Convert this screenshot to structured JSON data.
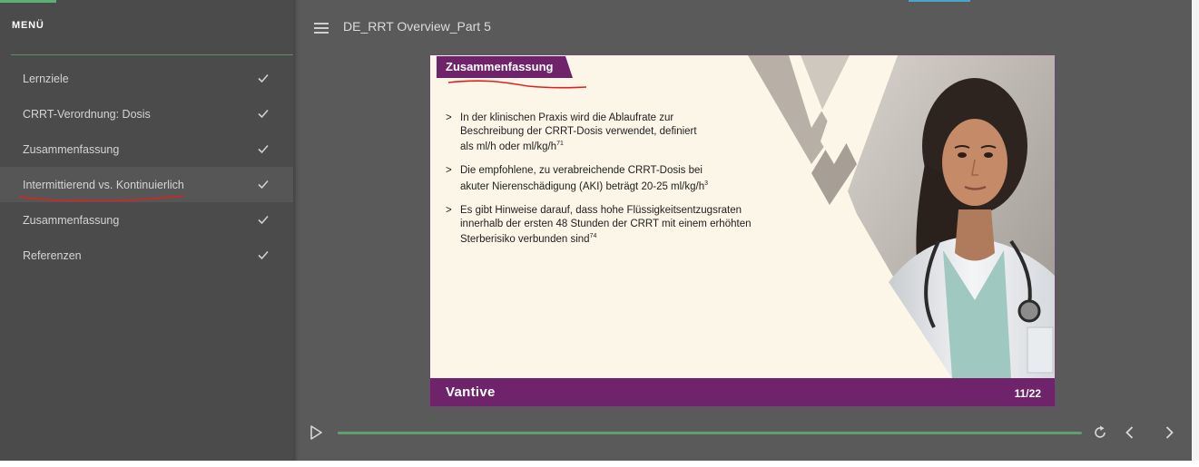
{
  "sidebar": {
    "title": "MENÜ",
    "items": [
      {
        "label": "Lernziele"
      },
      {
        "label": "CRRT-Verordnung: Dosis"
      },
      {
        "label": "Zusammenfassung"
      },
      {
        "label": "Intermittierend vs. Kontinuierlich"
      },
      {
        "label": "Zusammenfassung"
      },
      {
        "label": "Referenzen"
      }
    ],
    "active_index": 3
  },
  "header": {
    "title": "DE_RRT Overview_Part 5"
  },
  "slide": {
    "heading": "Zusammenfassung",
    "bullets": [
      {
        "line1": "In der klinischen Praxis wird die Ablaufrate zur",
        "line2": "Beschreibung der CRRT-Dosis verwendet, definiert",
        "line3": "als ml/h oder ml/kg/h",
        "ref": "71"
      },
      {
        "line1": "Die empfohlene, zu verabreichende CRRT-Dosis bei",
        "line2": "akuter Nierenschädigung (AKI) beträgt 20-25 ml/kg/h",
        "ref": "3"
      },
      {
        "line1": "Es gibt Hinweise darauf, dass hohe Flüssigkeitsentzugsraten",
        "line2": "innerhalb der ersten 48 Stunden der CRRT mit einem erhöhten",
        "line3": "Sterberisiko verbunden sind",
        "ref": "74"
      }
    ],
    "brand": "Vantive",
    "page": "11/22"
  },
  "colors": {
    "sidebar_bg": "#4b4b4b",
    "main_bg": "#5a5a5a",
    "slide_bg": "#fcf6e8",
    "accent_purple": "#6f236a",
    "progress_green": "#5fa06e",
    "annotation_red": "#e02020"
  },
  "icons": {
    "menu": "hamburger-icon",
    "check": "checkmark-icon",
    "play": "play-icon",
    "replay": "replay-icon",
    "prev": "chevron-left-icon",
    "next": "chevron-right-icon"
  }
}
